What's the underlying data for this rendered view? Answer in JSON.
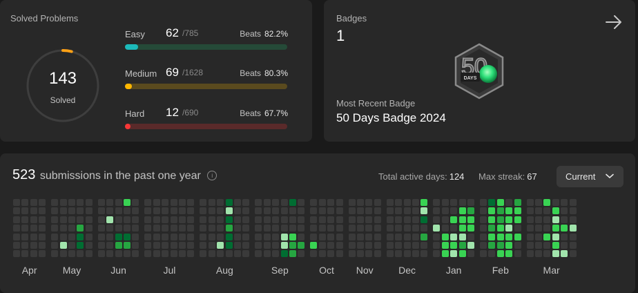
{
  "solved": {
    "title": "Solved Problems",
    "total": "143",
    "total_label": "Solved",
    "ring_fraction": 0.04,
    "ring_color": "#ffa116",
    "difficulties": [
      {
        "name": "Easy",
        "solved": "62",
        "total": "/785",
        "beats_label": "Beats",
        "beats": "82.2%",
        "fraction": 0.079,
        "color": "#1cbaba",
        "track": "#254a38"
      },
      {
        "name": "Medium",
        "solved": "69",
        "total": "/1628",
        "beats_label": "Beats",
        "beats": "80.3%",
        "fraction": 0.042,
        "color": "#ffb700",
        "track": "#5a4a1e"
      },
      {
        "name": "Hard",
        "solved": "12",
        "total": "/690",
        "beats_label": "Beats",
        "beats": "67.7%",
        "fraction": 0.017,
        "color": "#f63737",
        "track": "#5a2a2a"
      }
    ]
  },
  "badges": {
    "label": "Badges",
    "count": "1",
    "recent_label": "Most Recent Badge",
    "recent_name": "50 Days Badge 2024",
    "badge_text": "DAYS",
    "badge_numeral": "50",
    "arrow_icon": "arrow-right-icon"
  },
  "submissions": {
    "count": "523",
    "text": "submissions in the past one year",
    "info_icon": "i",
    "active_days_label": "Total active days:",
    "active_days": "124",
    "max_streak_label": "Max streak:",
    "max_streak": "67",
    "select_value": "Current",
    "colors": {
      "empty": "#3a3a3a",
      "l1": "#0e4429",
      "l2": "#006d32",
      "l3": "#26a641",
      "l4": "#39d353",
      "l5": "#a1e4ac"
    },
    "months": [
      {
        "name": "Apr",
        "weeks": [
          "0000000",
          "0000000",
          "0000000",
          "0000000"
        ]
      },
      {
        "name": "May",
        "weeks": [
          "0000000",
          "0000050",
          "0000000",
          "0003220",
          "0000000"
        ]
      },
      {
        "name": "Jun",
        "weeks": [
          "0000000",
          "0050000",
          "0000230",
          "4000230",
          "0000000"
        ]
      },
      {
        "name": "Jul",
        "weeks": [
          "0000000",
          "0000000",
          "0000000",
          "0000000",
          "0000000",
          "0000000"
        ]
      },
      {
        "name": "Aug",
        "weeks": [
          "0000000",
          "0000000",
          "0000050",
          "2523220",
          "0000000",
          "0000000"
        ]
      },
      {
        "name": "Sep",
        "weeks": [
          "0000000",
          "0000000",
          "0000000",
          "0000552",
          "2000433",
          "0000030"
        ]
      },
      {
        "name": "Oct",
        "weeks": [
          "0000040",
          "0000000",
          "0000000",
          "0000000"
        ]
      },
      {
        "name": "Nov",
        "weeks": [
          "0000000",
          "0000000",
          "0000000",
          "0000000"
        ]
      },
      {
        "name": "Dec",
        "weeks": [
          "0000000",
          "0000000",
          "0000000",
          "0000000",
          "4520300"
        ]
      },
      {
        "name": "Jan",
        "weeks": [
          "0005000",
          "0000444",
          "0040545",
          "0444534",
          "0344050"
        ]
      },
      {
        "name": "Feb",
        "weeks": [
          "0000000",
          "2443430",
          "4334434",
          "0445444",
          "3440400"
        ]
      },
      {
        "name": "Mar",
        "weeks": [
          "0000000",
          "0000000",
          "4000400",
          "0454545",
          "0004005",
          "0005000"
        ]
      }
    ]
  }
}
